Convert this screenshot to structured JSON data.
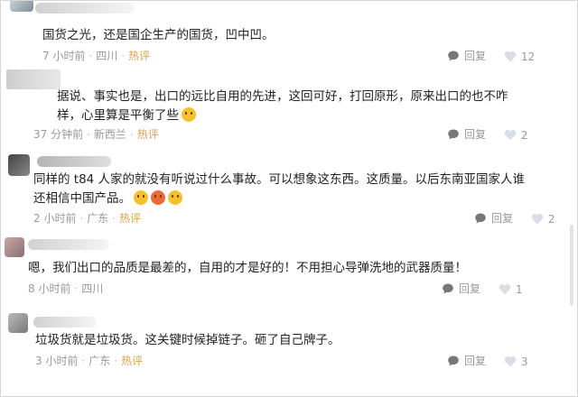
{
  "comments": [
    {
      "text": "国货之光，还是国企生产的国货，凹中凹。",
      "time": "7 小时前",
      "location": "四川",
      "hot": "热评",
      "reply": "回复",
      "likes": "12"
    },
    {
      "text": "据说、事实也是，出口的远比自用的先进，这回可好，打回原形，原来出口的也不咋样，心里算是平衡了些",
      "time": "37 分钟前",
      "location": "新西兰",
      "hot": "热评",
      "reply": "回复",
      "likes": "2"
    },
    {
      "text": "同样的 t84 人家的就没有听说过什么事故。可以想象这东西。这质量。以后东南亚国家人谁还相信中国产品。",
      "time": "2 小时前",
      "location": "广东",
      "hot": "热评",
      "reply": "回复",
      "likes": "2"
    },
    {
      "text": "嗯，我们出口的品质是最差的，自用的才是好的！不用担心导弹洗地的武器质量！",
      "time": "8 小时前",
      "location": "四川",
      "hot": "",
      "reply": "回复",
      "likes": "1"
    },
    {
      "text": "垃圾货就是垃圾货。这关键时候掉链子。砸了自己牌子。",
      "time": "3 小时前",
      "location": "广东",
      "hot": "热评",
      "reply": "回复",
      "likes": "3"
    }
  ],
  "icons": {
    "reply": "comment-bubble-icon",
    "like": "heart-icon",
    "emoji": "face-emoji-icon"
  },
  "colors": {
    "hot": "#e0a14b",
    "meta": "#999999"
  }
}
